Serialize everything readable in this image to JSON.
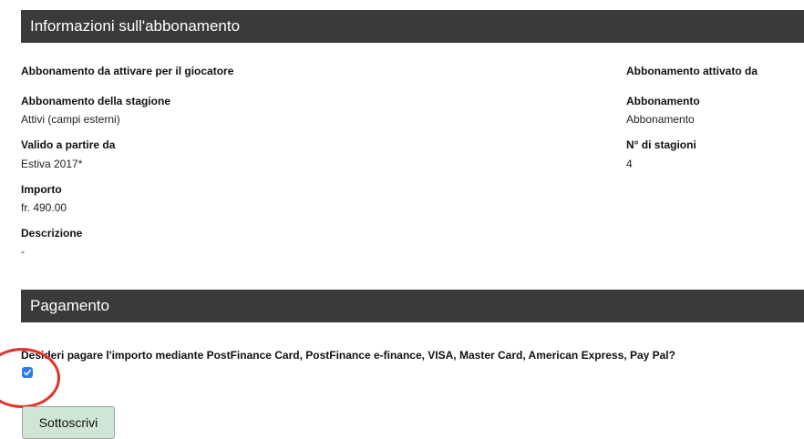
{
  "info_section": {
    "title": "Informazioni sull'abbonamento",
    "left": {
      "player_heading": "Abbonamento da attivare per il giocatore",
      "season_label": "Abbonamento della stagione",
      "season_value": "Attivi (campi esterni)",
      "valid_from_label": "Valido a partire da",
      "valid_from_value": "Estiva 2017*",
      "amount_label": "Importo",
      "amount_value": "fr. 490.00",
      "description_label": "Descrizione",
      "description_value": "-"
    },
    "right": {
      "activated_by_heading": "Abbonamento attivato da",
      "subscription_label": "Abbonamento",
      "subscription_value": "Abbonamento",
      "seasons_label": "N° di stagioni",
      "seasons_value": "4"
    }
  },
  "payment_section": {
    "title": "Pagamento",
    "question": "Desideri pagare l'importo mediante PostFinance Card, PostFinance e-finance, VISA, Master Card, American Express, Pay Pal?",
    "checkbox_checked": true,
    "submit_label": "Sottoscrivi"
  },
  "colors": {
    "header_bg": "#3a3a3a",
    "checkbox": "#2b7bf0",
    "annotation_circle": "#e2332b",
    "submit_bg": "#cfe6d6"
  }
}
